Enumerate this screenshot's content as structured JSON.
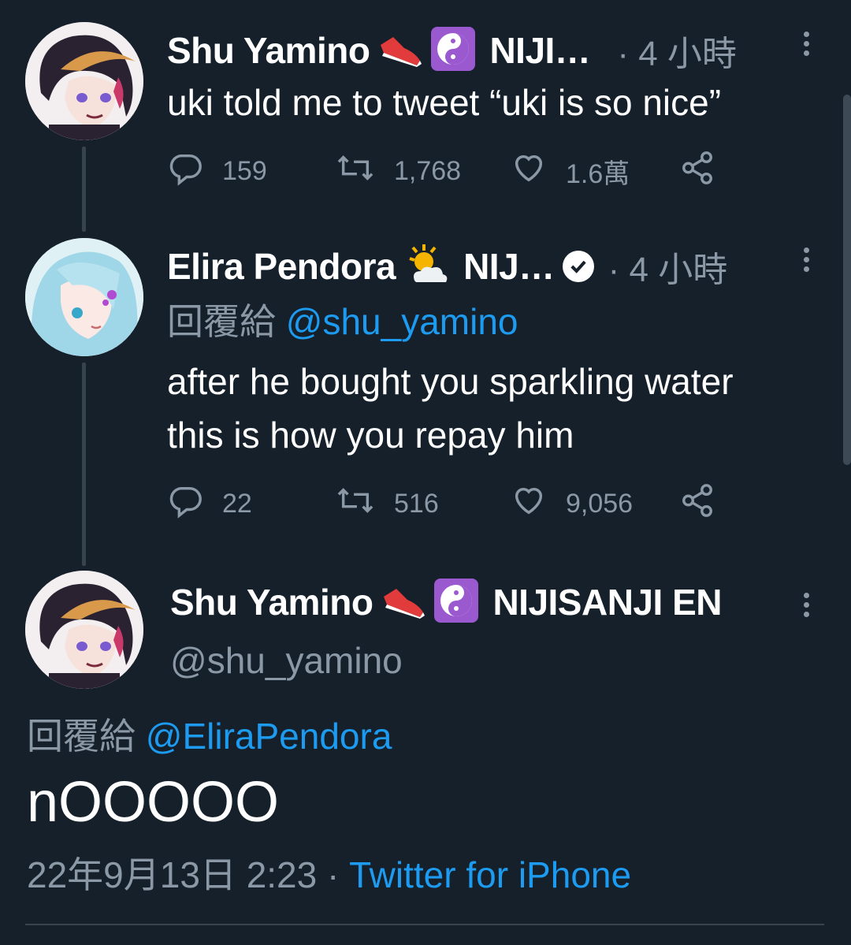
{
  "tweet1": {
    "name": "Shu Yamino",
    "name_suffix": "NIJI…",
    "time": "· 4 小時",
    "text": "uki told me to tweet “uki is so nice”",
    "replies": "159",
    "retweets": "1,768",
    "likes": "1.6萬"
  },
  "tweet2": {
    "name": "Elira Pendora",
    "name_suffix": "NIJ…",
    "time": "· 4 小時",
    "reply_prefix": "回覆給",
    "reply_handle": "@shu_yamino",
    "text_line1": "after he bought you sparkling water",
    "text_line2": "this is how you repay him",
    "replies": "22",
    "retweets": "516",
    "likes": "9,056"
  },
  "main": {
    "name": "Shu Yamino",
    "name_suffix": "NIJISANJI EN",
    "handle": "@shu_yamino",
    "reply_prefix": "回覆給",
    "reply_handle": "@EliraPendora",
    "text": "nOOOOO",
    "date": "22年9月13日 2:23",
    "separator": "·",
    "source": "Twitter for iPhone"
  },
  "colors": {
    "background": "#15202b",
    "link": "#1d9bf0",
    "muted": "#8b98a5"
  }
}
